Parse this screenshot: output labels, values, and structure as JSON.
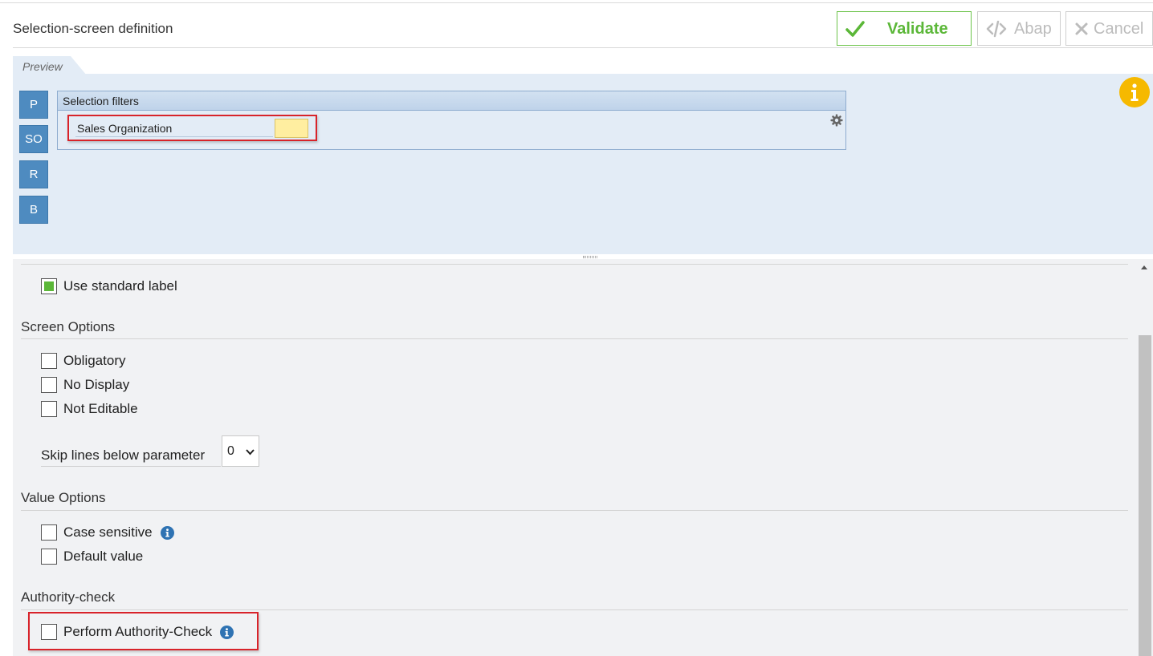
{
  "header": {
    "title": "Selection-screen definition",
    "validate_label": "Validate",
    "abap_label": "Abap",
    "cancel_label": "Cancel"
  },
  "preview": {
    "tab_label": "Preview",
    "side_buttons": [
      "P",
      "SO",
      "R",
      "B"
    ],
    "filters_title": "Selection filters",
    "filter_field_label": "Sales Organization",
    "filter_field_value": ""
  },
  "details": {
    "use_standard_label": {
      "label": "Use standard label",
      "checked": true
    },
    "screen_options": {
      "title": "Screen Options",
      "items": [
        {
          "label": "Obligatory",
          "checked": false
        },
        {
          "label": "No Display",
          "checked": false
        },
        {
          "label": "Not Editable",
          "checked": false
        }
      ],
      "skip_lines_label": "Skip lines below parameter",
      "skip_lines_value": "0"
    },
    "value_options": {
      "title": "Value Options",
      "items": [
        {
          "label": "Case sensitive",
          "checked": false
        },
        {
          "label": "Default value",
          "checked": false
        }
      ]
    },
    "authority_check": {
      "title": "Authority-check",
      "item": {
        "label": "Perform Authority-Check",
        "checked": false
      }
    }
  },
  "colors": {
    "accent_green": "#5bb738",
    "preview_bg": "#e3ecf6",
    "side_button_blue": "#4e8bc0",
    "highlight_red": "#d8232a",
    "info_yellow": "#f6b900",
    "info_blue": "#2f73b3"
  },
  "icons": {
    "validate": "check-icon",
    "abap": "code-icon",
    "cancel": "close-icon",
    "info": "info-icon",
    "settings": "gear-icon",
    "select": "chevron-down-icon"
  }
}
